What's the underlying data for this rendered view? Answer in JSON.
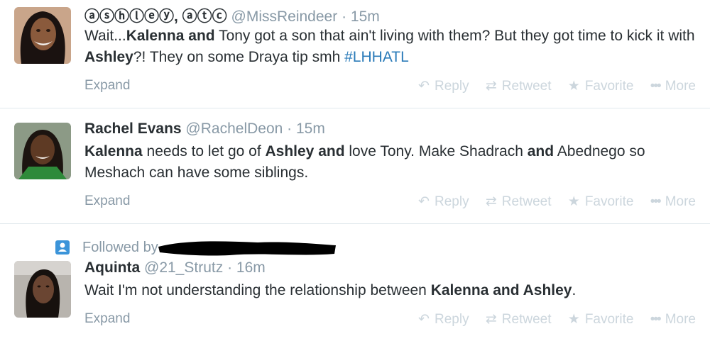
{
  "actions": {
    "reply": "Reply",
    "retweet": "Retweet",
    "favorite": "Favorite",
    "more": "More",
    "expand": "Expand"
  },
  "colors": {
    "link": "#2b7bb9",
    "muted": "#8899a6",
    "action": "#ccd6dd",
    "follow_icon": "#3b94d9"
  },
  "tweets": [
    {
      "fullname": "ⓐⓢⓗⓛⓔⓨ, ⓐⓣⓒ",
      "username": "@MissReindeer",
      "separator": "·",
      "time": "15m",
      "text_parts": [
        "Wait...",
        "Kalenna and",
        " Tony got a son that ain't living with them? But they got time to kick it with ",
        "Ashley",
        "?! They on some Draya tip smh ",
        "#LHHATL"
      ]
    },
    {
      "fullname": "Rachel Evans",
      "username": "@RachelDeon",
      "separator": "·",
      "time": "15m",
      "text_parts": [
        "Kalenna",
        " needs to let go of ",
        "Ashley and",
        " love Tony.  Make Shadrach ",
        "and",
        " Abednego so Meshach can have some siblings."
      ]
    },
    {
      "followed_by": "Followed by",
      "fullname": "Aquinta",
      "username": "@21_Strutz",
      "separator": "·",
      "time": "16m",
      "text_parts": [
        "Wait I'm not understanding the relationship between ",
        "Kalenna and Ashley",
        "."
      ]
    }
  ]
}
